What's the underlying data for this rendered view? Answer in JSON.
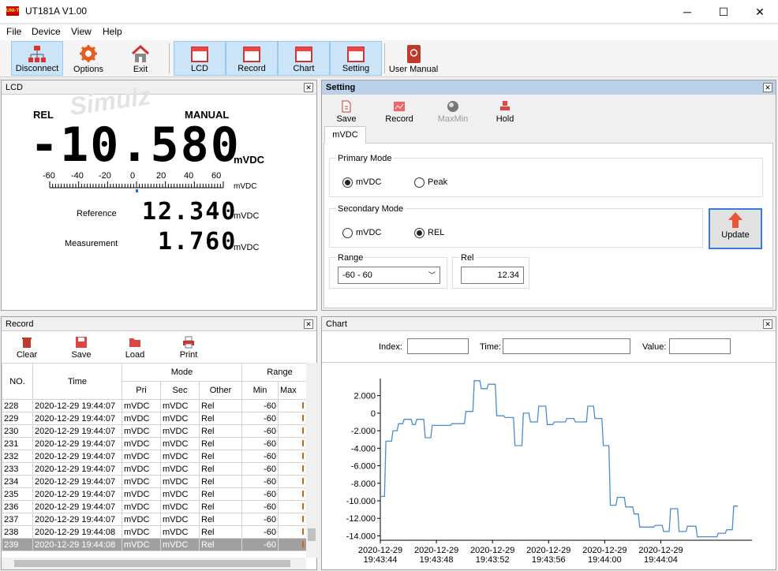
{
  "window": {
    "title": "UT181A V1.00",
    "app_icon_text": "UNI-T",
    "min": "─",
    "max": "☐",
    "close": "✕"
  },
  "menu": [
    "File",
    "Device",
    "View",
    "Help"
  ],
  "toolbar": {
    "disconnect": "Disconnect",
    "options": "Options",
    "exit": "Exit",
    "lcd": "LCD",
    "record": "Record",
    "chart": "Chart",
    "setting": "Setting",
    "user_manual": "User Manual"
  },
  "lcd": {
    "title": "LCD",
    "watermark": "Simulz",
    "rel": "REL",
    "manual": "MANUAL",
    "main_value": "-10.580",
    "main_unit": "mVDC",
    "scale": [
      "-60",
      "-40",
      "-20",
      "0",
      "20",
      "40",
      "60"
    ],
    "scale_unit": "mVDC",
    "bar_level": 0.0,
    "ref_label": "Reference",
    "ref_value": "12.340",
    "ref_unit": "mVDC",
    "meas_label": "Measurement",
    "meas_value": "1.760",
    "meas_unit": "mVDC"
  },
  "setting": {
    "title": "Setting",
    "save": "Save",
    "record": "Record",
    "maxmin": "MaxMin",
    "hold": "Hold",
    "tab": "mVDC",
    "primary_mode": "Primary Mode",
    "p_opt1": "mVDC",
    "p_opt2": "Peak",
    "secondary_mode": "Secondary Mode",
    "s_opt1": "mVDC",
    "s_opt2": "REL",
    "update": "Update",
    "range": "Range",
    "range_value": "-60 - 60",
    "rel": "Rel",
    "rel_value": "12.34"
  },
  "record": {
    "title": "Record",
    "clear": "Clear",
    "save": "Save",
    "load": "Load",
    "print": "Print",
    "headers": {
      "no": "NO.",
      "time": "Time",
      "mode": "Mode",
      "range": "Range",
      "pri": "Pri",
      "sec": "Sec",
      "other": "Other",
      "min": "Min",
      "max": "Max"
    },
    "rows": [
      [
        "228",
        "2020-12-29 19:44:07",
        "mVDC",
        "mVDC",
        "Rel",
        "-60"
      ],
      [
        "229",
        "2020-12-29 19:44:07",
        "mVDC",
        "mVDC",
        "Rel",
        "-60"
      ],
      [
        "230",
        "2020-12-29 19:44:07",
        "mVDC",
        "mVDC",
        "Rel",
        "-60"
      ],
      [
        "231",
        "2020-12-29 19:44:07",
        "mVDC",
        "mVDC",
        "Rel",
        "-60"
      ],
      [
        "232",
        "2020-12-29 19:44:07",
        "mVDC",
        "mVDC",
        "Rel",
        "-60"
      ],
      [
        "233",
        "2020-12-29 19:44:07",
        "mVDC",
        "mVDC",
        "Rel",
        "-60"
      ],
      [
        "234",
        "2020-12-29 19:44:07",
        "mVDC",
        "mVDC",
        "Rel",
        "-60"
      ],
      [
        "235",
        "2020-12-29 19:44:07",
        "mVDC",
        "mVDC",
        "Rel",
        "-60"
      ],
      [
        "236",
        "2020-12-29 19:44:07",
        "mVDC",
        "mVDC",
        "Rel",
        "-60"
      ],
      [
        "237",
        "2020-12-29 19:44:07",
        "mVDC",
        "mVDC",
        "Rel",
        "-60"
      ],
      [
        "238",
        "2020-12-29 19:44:08",
        "mVDC",
        "mVDC",
        "Rel",
        "-60"
      ],
      [
        "239",
        "2020-12-29 19:44:08",
        "mVDC",
        "mVDC",
        "Rel",
        "-60"
      ]
    ]
  },
  "chart": {
    "title": "Chart",
    "index": "Index:",
    "time": "Time:",
    "value": "Value:"
  },
  "chart_data": {
    "type": "line",
    "y_ticks": [
      "2.000",
      "0",
      "-2.000",
      "-4.000",
      "-6.000",
      "-8.000",
      "-10.000",
      "-12.000",
      "-14.000"
    ],
    "ylim": [
      -14.5,
      3.5
    ],
    "x_ticks": [
      [
        "2020-12-29",
        "19:43:44"
      ],
      [
        "2020-12-29",
        "19:43:48"
      ],
      [
        "2020-12-29",
        "19:43:52"
      ],
      [
        "2020-12-29",
        "19:43:56"
      ],
      [
        "2020-12-29",
        "19:44:00"
      ],
      [
        "2020-12-29",
        "19:44:04"
      ]
    ],
    "xlim": [
      0,
      26.5
    ],
    "line_color": "#4a8ccf",
    "points": [
      [
        0,
        -9.5
      ],
      [
        0.3,
        -9.5
      ],
      [
        0.4,
        -3.2
      ],
      [
        0.8,
        -3.2
      ],
      [
        0.9,
        -2
      ],
      [
        1.2,
        -2
      ],
      [
        1.3,
        -1.2
      ],
      [
        1.6,
        -1.2
      ],
      [
        1.7,
        -0.7
      ],
      [
        2.2,
        -0.7
      ],
      [
        2.3,
        -1.3
      ],
      [
        2.5,
        -1.3
      ],
      [
        2.6,
        -0.7
      ],
      [
        3.1,
        -0.7
      ],
      [
        3.2,
        -2.8
      ],
      [
        3.6,
        -2.8
      ],
      [
        3.7,
        -1.4
      ],
      [
        5,
        -1.4
      ],
      [
        5.1,
        -1.2
      ],
      [
        6,
        -1.2
      ],
      [
        6.1,
        0.2
      ],
      [
        6.6,
        0.2
      ],
      [
        6.7,
        3.7
      ],
      [
        7.1,
        3.7
      ],
      [
        7.2,
        2.8
      ],
      [
        7.6,
        2.8
      ],
      [
        7.7,
        3.3
      ],
      [
        8.2,
        3.3
      ],
      [
        8.3,
        -0.3
      ],
      [
        8.8,
        -0.3
      ],
      [
        8.9,
        -0.5
      ],
      [
        9.5,
        -0.5
      ],
      [
        9.6,
        -3.7
      ],
      [
        10.1,
        -3.7
      ],
      [
        10.2,
        0
      ],
      [
        10.6,
        0
      ],
      [
        10.7,
        -1
      ],
      [
        11.2,
        -1
      ],
      [
        11.3,
        0.8
      ],
      [
        11.8,
        0.8
      ],
      [
        11.9,
        -1.3
      ],
      [
        12.3,
        -1.3
      ],
      [
        12.4,
        -1
      ],
      [
        13.2,
        -1
      ],
      [
        13.3,
        -0.6
      ],
      [
        13.8,
        -0.6
      ],
      [
        13.9,
        -1
      ],
      [
        14.7,
        -1
      ],
      [
        14.8,
        0.8
      ],
      [
        15.2,
        0.8
      ],
      [
        15.3,
        -0.6
      ],
      [
        15.8,
        -0.6
      ],
      [
        15.9,
        -3.7
      ],
      [
        16.3,
        -3.7
      ],
      [
        16.4,
        -10.5
      ],
      [
        16.8,
        -10.5
      ],
      [
        16.9,
        -9.6
      ],
      [
        17.4,
        -9.6
      ],
      [
        17.5,
        -10.7
      ],
      [
        18,
        -10.7
      ],
      [
        18.1,
        -11.5
      ],
      [
        18.4,
        -11.5
      ],
      [
        18.5,
        -13
      ],
      [
        19.5,
        -13
      ],
      [
        19.6,
        -12.8
      ],
      [
        20.1,
        -12.8
      ],
      [
        20.2,
        -13.5
      ],
      [
        20.6,
        -13.5
      ],
      [
        20.7,
        -10.9
      ],
      [
        21.2,
        -10.9
      ],
      [
        21.3,
        -13.5
      ],
      [
        21.8,
        -13.5
      ],
      [
        21.9,
        -12.9
      ],
      [
        22.5,
        -12.9
      ],
      [
        22.6,
        -14.1
      ],
      [
        24,
        -14.1
      ],
      [
        24.1,
        -13.7
      ],
      [
        24.6,
        -13.7
      ],
      [
        24.7,
        -13.3
      ],
      [
        25.1,
        -13.3
      ],
      [
        25.2,
        -10.6
      ],
      [
        25.5,
        -10.6
      ]
    ]
  }
}
